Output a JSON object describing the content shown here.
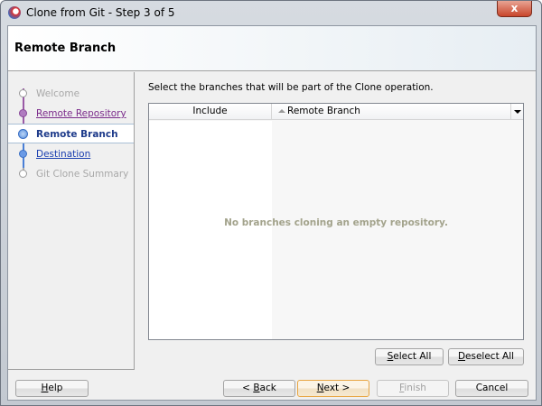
{
  "window": {
    "title": "Clone from Git - Step 3 of 5",
    "close_label": "x"
  },
  "banner": {
    "title": "Remote Branch"
  },
  "steps": [
    {
      "label": "Welcome",
      "state": "disabled"
    },
    {
      "label": "Remote Repository",
      "state": "visited"
    },
    {
      "label": "Remote Branch",
      "state": "current"
    },
    {
      "label": "Destination",
      "state": "link"
    },
    {
      "label": "Git Clone Summary",
      "state": "disabled"
    }
  ],
  "main": {
    "instruction": "Select the branches that will be part of the Clone operation.",
    "columns": [
      "Include",
      "Remote Branch"
    ],
    "empty_message": "No branches cloning an empty repository."
  },
  "buttons": {
    "select_all": {
      "m": "S",
      "rest": "elect All"
    },
    "deselect_all": {
      "m": "D",
      "rest": "eselect All"
    },
    "help": {
      "m": "H",
      "rest": "elp"
    },
    "back": {
      "pre": "< ",
      "m": "B",
      "rest": "ack"
    },
    "next": {
      "m": "N",
      "rest": "ext >"
    },
    "finish": {
      "m": "F",
      "rest": "inish"
    },
    "cancel": "Cancel"
  }
}
